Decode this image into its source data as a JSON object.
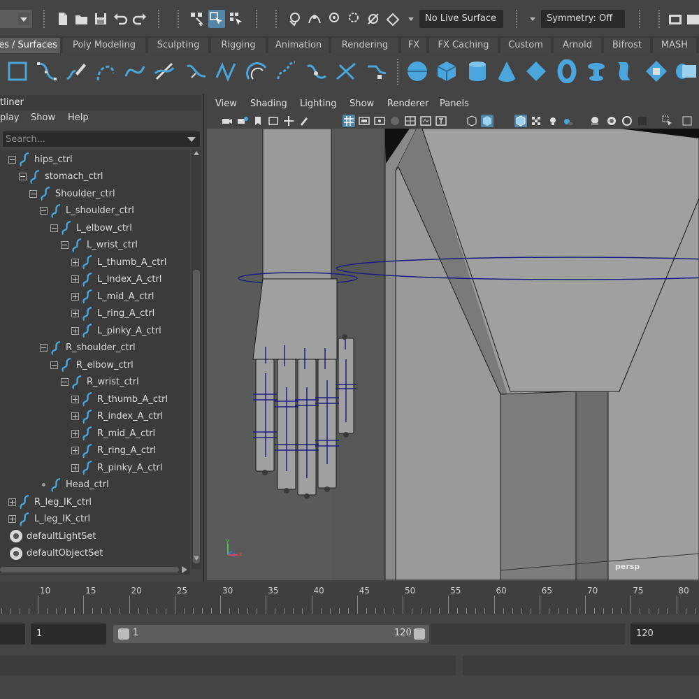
{
  "status_line": {
    "live_surface": "No Live Surface",
    "symmetry": "Symmetry: Off"
  },
  "shelf_tabs": [
    "es / Surfaces",
    "Poly Modeling",
    "Sculpting",
    "Rigging",
    "Animation",
    "Rendering",
    "FX",
    "FX Caching",
    "Custom",
    "Arnold",
    "Bifrost",
    "MASH"
  ],
  "shelf_icons": [
    "square-curve-icon",
    "cv-curve-icon",
    "pencil-curve-icon",
    "ep-curve-icon",
    "bezier-curve-icon",
    "curve-edit-icon",
    "arc-curve-icon",
    "sine-curve-icon",
    "circle-arc-icon",
    "attach-curve-icon",
    "detach-curve-icon",
    "intersect-icon",
    "trim-curve-icon",
    "sphere-icon",
    "cube-icon",
    "cylinder-icon",
    "cone-icon",
    "plane-icon",
    "torus-icon",
    "revolve-icon",
    "loft-icon",
    "planar-icon",
    "extrude-icon"
  ],
  "outliner": {
    "title": "tliner",
    "menu": [
      "play",
      "Show",
      "Help"
    ],
    "search_placeholder": "Search...",
    "items": [
      {
        "label": "hips_ctrl",
        "indent": 0,
        "exp": "minus",
        "icon": "curve"
      },
      {
        "label": "stomach_ctrl",
        "indent": 1,
        "exp": "minus",
        "icon": "curve"
      },
      {
        "label": "Shoulder_ctrl",
        "indent": 2,
        "exp": "minus",
        "icon": "curve"
      },
      {
        "label": "L_shoulder_ctrl",
        "indent": 3,
        "exp": "minus",
        "icon": "curve"
      },
      {
        "label": "L_elbow_ctrl",
        "indent": 4,
        "exp": "minus",
        "icon": "curve"
      },
      {
        "label": "L_wrist_ctrl",
        "indent": 5,
        "exp": "minus",
        "icon": "curve"
      },
      {
        "label": "L_thumb_A_ctrl",
        "indent": 6,
        "exp": "plus",
        "icon": "curve"
      },
      {
        "label": "L_index_A_ctrl",
        "indent": 6,
        "exp": "plus",
        "icon": "curve"
      },
      {
        "label": "L_mid_A_ctrl",
        "indent": 6,
        "exp": "plus",
        "icon": "curve"
      },
      {
        "label": "L_ring_A_ctrl",
        "indent": 6,
        "exp": "plus",
        "icon": "curve"
      },
      {
        "label": "L_pinky_A_ctrl",
        "indent": 6,
        "exp": "plus",
        "icon": "curve"
      },
      {
        "label": "R_shoulder_ctrl",
        "indent": 3,
        "exp": "minus",
        "icon": "curve"
      },
      {
        "label": "R_elbow_ctrl",
        "indent": 4,
        "exp": "minus",
        "icon": "curve"
      },
      {
        "label": "R_wrist_ctrl",
        "indent": 5,
        "exp": "minus",
        "icon": "curve"
      },
      {
        "label": "R_thumb_A_ctrl",
        "indent": 6,
        "exp": "plus",
        "icon": "curve"
      },
      {
        "label": "R_index_A_ctrl",
        "indent": 6,
        "exp": "plus",
        "icon": "curve"
      },
      {
        "label": "R_mid_A_ctrl",
        "indent": 6,
        "exp": "plus",
        "icon": "curve"
      },
      {
        "label": "R_ring_A_ctrl",
        "indent": 6,
        "exp": "plus",
        "icon": "curve"
      },
      {
        "label": "R_pinky_A_ctrl",
        "indent": 6,
        "exp": "plus",
        "icon": "curve"
      },
      {
        "label": "Head_ctrl",
        "indent": 3,
        "exp": "dot",
        "icon": "curve"
      },
      {
        "label": "R_leg_IK_ctrl",
        "indent": 0,
        "exp": "plus",
        "icon": "curve"
      },
      {
        "label": "L_leg_IK_ctrl",
        "indent": 0,
        "exp": "plus",
        "icon": "curve"
      },
      {
        "label": "defaultLightSet",
        "indent": -1,
        "exp": "none",
        "icon": "set"
      },
      {
        "label": "defaultObjectSet",
        "indent": -1,
        "exp": "none",
        "icon": "set"
      }
    ]
  },
  "viewport": {
    "menu": [
      "View",
      "Shading",
      "Lighting",
      "Show",
      "Renderer",
      "Panels"
    ],
    "camera_label": "persp",
    "axis_labels": [
      "y",
      "z",
      "x"
    ]
  },
  "timeline": {
    "ticks": [
      10,
      15,
      20,
      25,
      30,
      35,
      40,
      45,
      50,
      55,
      60,
      65,
      70,
      75,
      80
    ]
  },
  "range": {
    "start_value": "1",
    "slider_start": "1",
    "slider_end": "120",
    "end_value": "120"
  },
  "colors": {
    "accent": "#5285a6",
    "shelf_icon": "#4aa6dc",
    "control_curve": "#1c1c80"
  }
}
